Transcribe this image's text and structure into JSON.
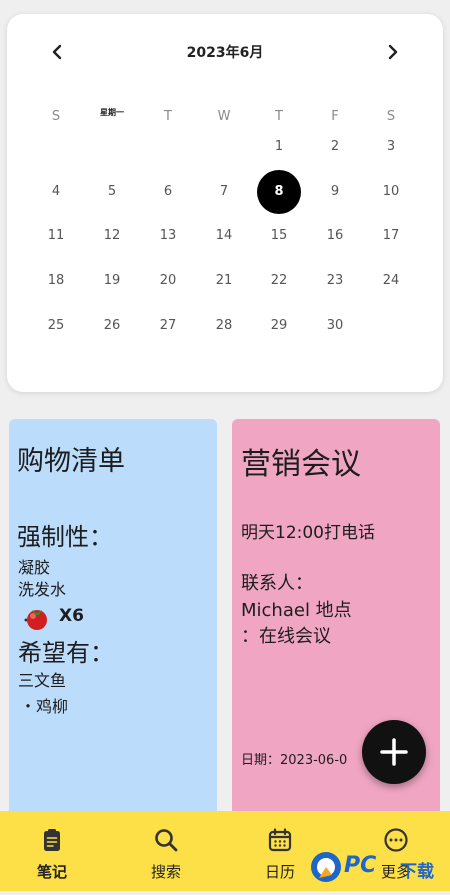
{
  "calendar": {
    "title": "2023年6月",
    "weekdays": [
      "S",
      "星期一",
      "T",
      "W",
      "T",
      "F",
      "S"
    ],
    "weeks": [
      [
        "",
        "",
        "",
        "",
        "1",
        "2",
        "3"
      ],
      [
        "4",
        "5",
        "6",
        "7",
        "8",
        "9",
        "10"
      ],
      [
        "11",
        "12",
        "13",
        "14",
        "15",
        "16",
        "17"
      ],
      [
        "18",
        "19",
        "20",
        "21",
        "22",
        "23",
        "24"
      ],
      [
        "25",
        "26",
        "27",
        "28",
        "29",
        "30",
        ""
      ]
    ],
    "selected_day": "8"
  },
  "notes": {
    "shopping": {
      "title": "购物清单",
      "required_heading": "强制性：",
      "items": [
        "凝胶",
        "洗发水"
      ],
      "tomato_qty": "X6",
      "wish_heading": "希望有：",
      "wish_items": [
        "三文鱼",
        "・鸡柳"
      ],
      "color": "#bcdcfb"
    },
    "meeting": {
      "title": "营销会议",
      "lines": [
        "明天12:00打电话",
        "联系人：",
        "Michael 地点",
        "：在线会议"
      ],
      "date": "日期：2023-06-0",
      "color": "#f0a6c3"
    }
  },
  "bottom_nav": {
    "items": [
      "笔记",
      "搜索",
      "日历",
      "更多"
    ],
    "active": "笔记",
    "color": "#fde047"
  },
  "watermark": {
    "text": "PC",
    "text2": "下载"
  }
}
